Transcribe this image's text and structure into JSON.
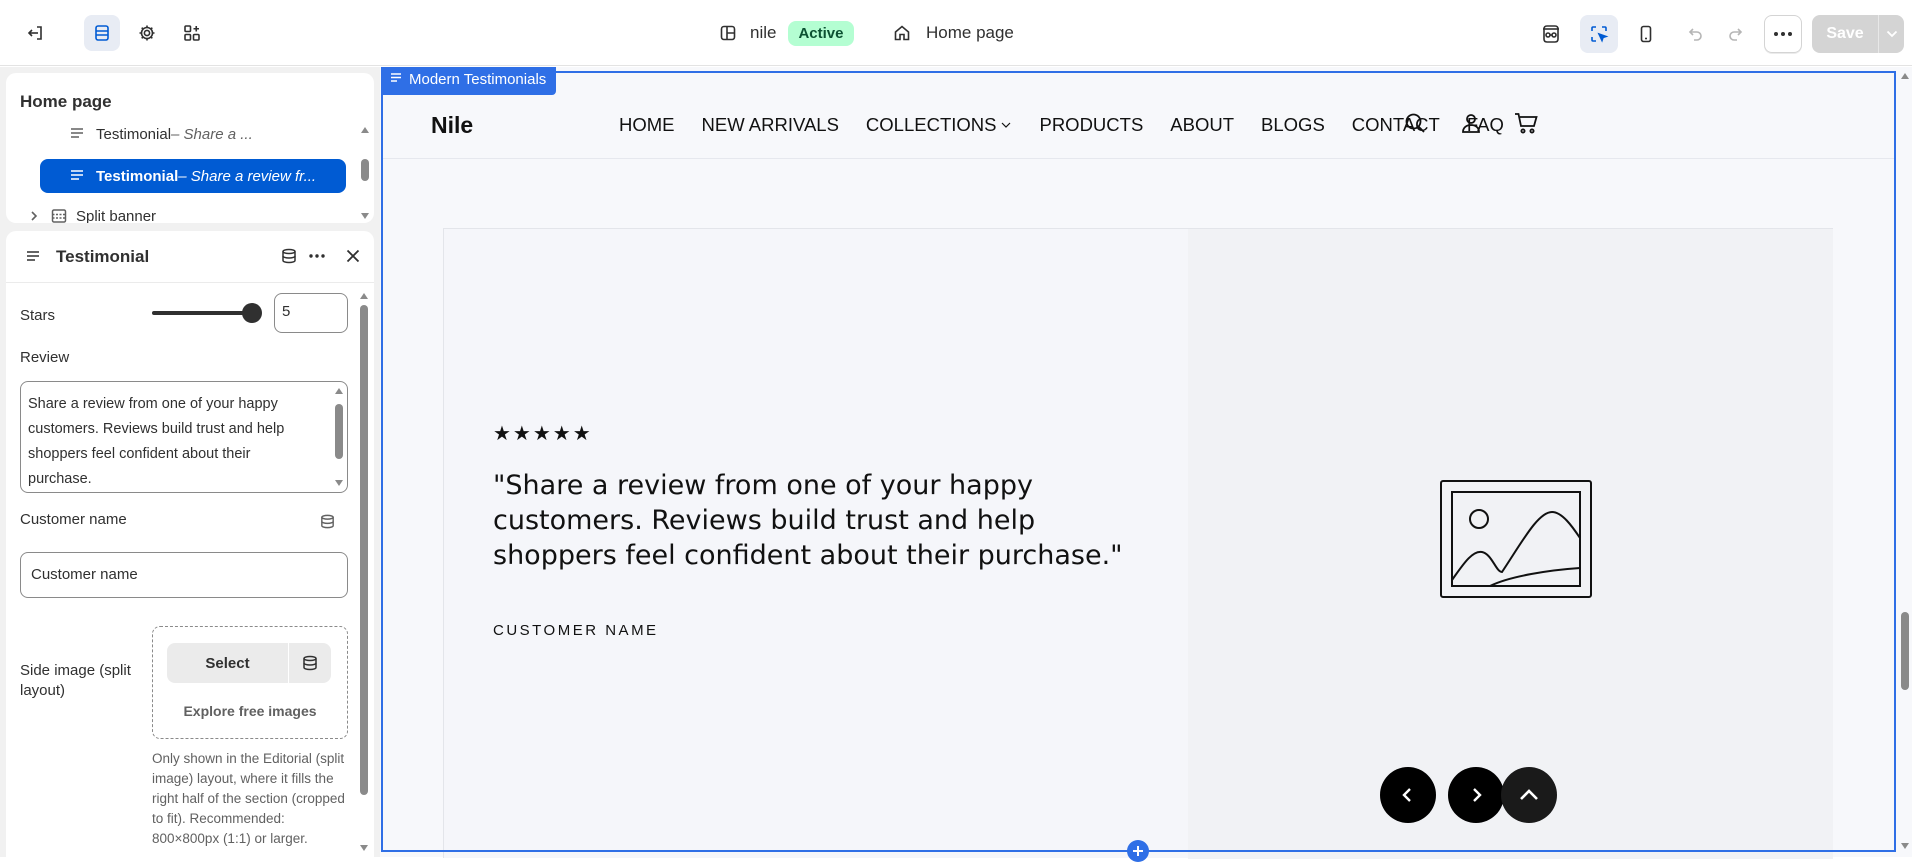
{
  "topbar": {
    "store_name": "nile",
    "status_badge": "Active",
    "page_name": "Home page",
    "save_label": "Save",
    "icons": [
      "exit-icon",
      "sections-icon",
      "gear-icon",
      "apps-icon",
      "theme-icon",
      "home-icon",
      "preview-icon",
      "inspector-icon",
      "mobile-icon",
      "undo-icon",
      "redo-icon",
      "more-icon",
      "chevron-down-icon"
    ]
  },
  "tree": {
    "title": "Home page",
    "items": [
      {
        "label": "Testimonial",
        "sub": " – Share a ..."
      },
      {
        "label": "Testimonial",
        "sub": " – Share a review fr..."
      },
      {
        "label": "Split banner",
        "sub": ""
      }
    ]
  },
  "panel": {
    "title": "Testimonial",
    "stars_label": "Stars",
    "stars_value": "5",
    "stars_level": 1.0,
    "review_label": "Review",
    "review_value": "Share a review from one of your happy customers. Reviews build trust and help shoppers feel confident about their purchase.",
    "customer_label": "Customer name",
    "customer_value": "Customer name",
    "side_image_label": "Side image (split layout)",
    "select_label": "Select",
    "explore_label": "Explore free images",
    "help_text": "Only shown in the Editorial (split image) layout, where it fills the right half of the section (cropped to fit). Recommended: 800×800px (1:1) or larger."
  },
  "preview": {
    "section_tag": "Modern Testimonials",
    "logo": "Nile",
    "nav": [
      "HOME",
      "NEW ARRIVALS",
      "COLLECTIONS",
      "PRODUCTS",
      "ABOUT",
      "BLOGS",
      "CONTACT",
      "FAQ"
    ],
    "stars": "★★★★★",
    "quote": "\"Share a review from one of your happy customers. Reviews build trust and help shoppers feel confident about their purchase.\"",
    "customer_name": "CUSTOMER NAME"
  },
  "colors": {
    "accent": "#005bd3",
    "frame": "#2f6fe6",
    "badge_bg": "#b4fed2",
    "badge_text": "#0c5132",
    "nav_button": "#000000"
  }
}
